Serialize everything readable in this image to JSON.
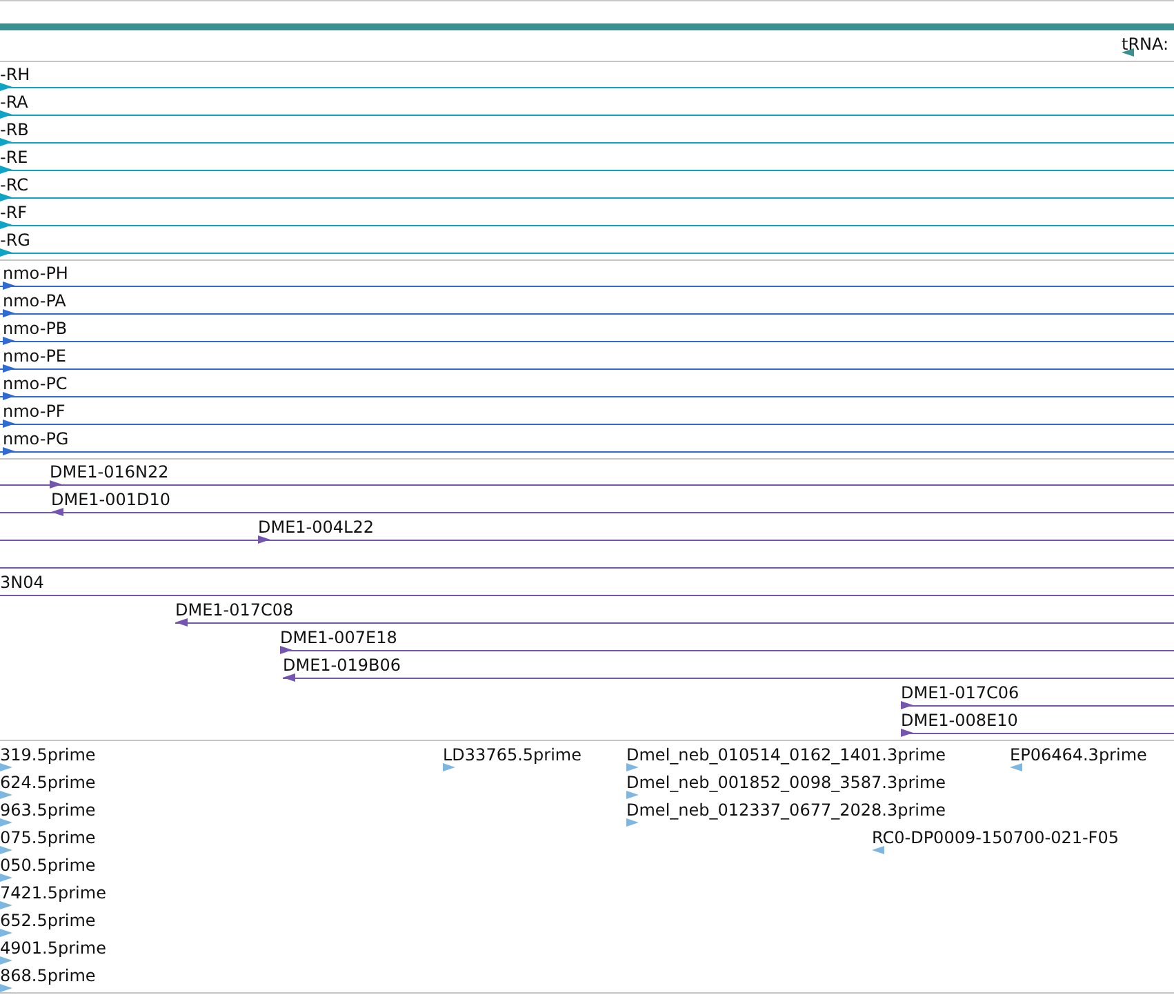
{
  "tracks": [
    {
      "kind": "gene",
      "color": "#3a8f8f",
      "rows": [
        {
          "kind": "bare",
          "features": [
            {
              "label": "tRNA:",
              "kind": "reverse"
            }
          ]
        }
      ]
    },
    {
      "kind": "transcript",
      "color": "#0fa3c6",
      "rows": [
        {
          "kind": "full",
          "features": [
            {
              "label": "-RH",
              "kind": "forward"
            }
          ]
        },
        {
          "kind": "full",
          "features": [
            {
              "label": "-RA",
              "kind": "forward"
            }
          ]
        },
        {
          "kind": "full",
          "features": [
            {
              "label": "-RB",
              "kind": "forward"
            }
          ]
        },
        {
          "kind": "full",
          "features": [
            {
              "label": "-RE",
              "kind": "forward"
            }
          ]
        },
        {
          "kind": "full",
          "features": [
            {
              "label": "-RC",
              "kind": "forward"
            }
          ]
        },
        {
          "kind": "full",
          "features": [
            {
              "label": "-RF",
              "kind": "forward"
            }
          ]
        },
        {
          "kind": "full",
          "features": [
            {
              "label": "-RG",
              "kind": "forward"
            }
          ]
        }
      ]
    },
    {
      "kind": "transcript",
      "color": "#2e6ad4",
      "rows": [
        {
          "kind": "full",
          "features": [
            {
              "label": "nmo-PH",
              "kind": "forward"
            }
          ]
        },
        {
          "kind": "full",
          "features": [
            {
              "label": "nmo-PA",
              "kind": "forward"
            }
          ]
        },
        {
          "kind": "full",
          "features": [
            {
              "label": "nmo-PB",
              "kind": "forward"
            }
          ]
        },
        {
          "kind": "full",
          "features": [
            {
              "label": "nmo-PE",
              "kind": "forward"
            }
          ]
        },
        {
          "kind": "full",
          "features": [
            {
              "label": "nmo-PC",
              "kind": "forward"
            }
          ]
        },
        {
          "kind": "full",
          "features": [
            {
              "label": "nmo-PF",
              "kind": "forward"
            }
          ]
        },
        {
          "kind": "full",
          "features": [
            {
              "label": "nmo-PG",
              "kind": "forward"
            }
          ]
        }
      ]
    },
    {
      "kind": "transcript",
      "color": "#7455b0",
      "rows": [
        {
          "kind": "full",
          "features": [
            {
              "label": "DME1-016N22",
              "kind": "forward"
            }
          ]
        },
        {
          "kind": "full",
          "features": [
            {
              "label": "DME1-001D10",
              "kind": "reverse"
            }
          ]
        },
        {
          "kind": "full",
          "features": [
            {
              "label": "DME1-004L22",
              "kind": "forward"
            }
          ]
        },
        {
          "kind": "full"
        },
        {
          "kind": "full",
          "features": [
            {
              "label": "3N04",
              "kind": "plain"
            }
          ]
        },
        {
          "kind": "partial",
          "features": [
            {
              "label": "DME1-017C08",
              "kind": "reverse"
            }
          ]
        },
        {
          "kind": "partial",
          "features": [
            {
              "label": "DME1-007E18",
              "kind": "forward"
            }
          ]
        },
        {
          "kind": "partial",
          "features": [
            {
              "label": "DME1-019B06",
              "kind": "reverse"
            }
          ]
        },
        {
          "kind": "partial",
          "features": [
            {
              "label": "DME1-017C06",
              "kind": "forward"
            }
          ]
        },
        {
          "kind": "partial",
          "features": [
            {
              "label": "DME1-008E10",
              "kind": "forward"
            }
          ]
        }
      ]
    },
    {
      "kind": "est",
      "color": "#7db7df",
      "rows": [
        {
          "kind": "bare",
          "features": [
            {
              "label": "319.5prime",
              "kind": "forward"
            },
            {
              "label": "LD33765.5prime",
              "kind": "forward"
            },
            {
              "label": "Dmel_neb_010514_0162_1401.3prime",
              "kind": "forward"
            },
            {
              "label": "EP06464.3prime",
              "kind": "reverse"
            }
          ]
        },
        {
          "kind": "bare",
          "features": [
            {
              "label": "624.5prime",
              "kind": "forward"
            },
            {
              "label": "Dmel_neb_001852_0098_3587.3prime",
              "kind": "forward"
            }
          ]
        },
        {
          "kind": "bare",
          "features": [
            {
              "label": "963.5prime",
              "kind": "forward"
            },
            {
              "label": "Dmel_neb_012337_0677_2028.3prime",
              "kind": "forward"
            }
          ]
        },
        {
          "kind": "bare",
          "features": [
            {
              "label": "075.5prime",
              "kind": "forward"
            },
            {
              "label": "RC0-DP0009-150700-021-F05",
              "kind": "reverse"
            }
          ]
        },
        {
          "kind": "bare",
          "features": [
            {
              "label": "050.5prime",
              "kind": "forward"
            }
          ]
        },
        {
          "kind": "bare",
          "features": [
            {
              "label": "7421.5prime",
              "kind": "forward"
            }
          ]
        },
        {
          "kind": "bare",
          "features": [
            {
              "label": "652.5prime",
              "kind": "forward"
            }
          ]
        },
        {
          "kind": "bare",
          "features": [
            {
              "label": "4901.5prime",
              "kind": "forward"
            }
          ]
        },
        {
          "kind": "bare",
          "features": [
            {
              "label": "868.5prime",
              "kind": "forward"
            }
          ]
        }
      ]
    }
  ]
}
